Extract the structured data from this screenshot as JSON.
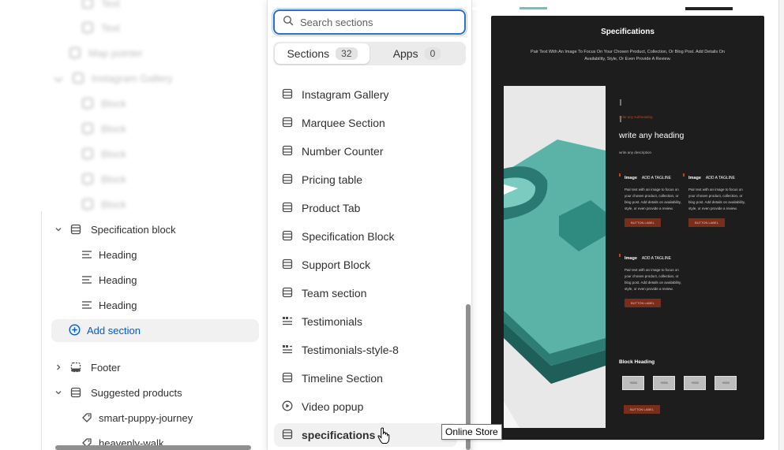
{
  "tree": {
    "blurred_items": [
      "Text",
      "Text",
      "Map pointer",
      "Instagram Gallery",
      "Block",
      "Block",
      "Block",
      "Block",
      "Block"
    ],
    "specification_block": {
      "label": "Specification block",
      "children": [
        "Heading",
        "Heading",
        "Heading"
      ]
    },
    "add_section_label": "Add section",
    "footer_label": "Footer",
    "suggested_products": {
      "label": "Suggested products",
      "children": [
        "smart-puppy-journey",
        "heavenly-walk"
      ]
    }
  },
  "picker": {
    "search_placeholder": "Search sections",
    "tabs": [
      {
        "label": "Sections",
        "count": "32",
        "active": true
      },
      {
        "label": "Apps",
        "count": "0",
        "active": false
      }
    ],
    "items": [
      {
        "label": "Instagram Gallery",
        "icon": "section-icon"
      },
      {
        "label": "Marquee Section",
        "icon": "section-icon"
      },
      {
        "label": "Number Counter",
        "icon": "section-icon"
      },
      {
        "label": "Pricing table",
        "icon": "section-icon"
      },
      {
        "label": "Product Tab",
        "icon": "section-icon"
      },
      {
        "label": "Specification Block",
        "icon": "section-icon"
      },
      {
        "label": "Support Block",
        "icon": "section-icon"
      },
      {
        "label": "Team section",
        "icon": "section-icon"
      },
      {
        "label": "Testimonials",
        "icon": "testimonial-icon"
      },
      {
        "label": "Testimonials-style-8",
        "icon": "testimonial-icon"
      },
      {
        "label": "Timeline Section",
        "icon": "section-icon"
      },
      {
        "label": "Video popup",
        "icon": "play-icon"
      },
      {
        "label": "specifications",
        "icon": "section-icon",
        "selected": true
      }
    ]
  },
  "tooltip": "Online Store",
  "preview": {
    "title": "Specifications",
    "subtitle": "Pair Text With An Image To Focus On Your Chosen Product, Collection, Or Blog Post. Add Details On Availability, Style, Or Even Provide A Review.",
    "small_label": "write any subheading",
    "heading": "write any heading",
    "description": "write any description",
    "cards": [
      {
        "title": "Image",
        "tagline": "ADD A TAGLINE",
        "body": "Pair text with an image to focus on your chosen product, collection, or blog post. Add details on availability, style, or even provide a review.",
        "button": "BUTTON LABEL"
      },
      {
        "title": "Image",
        "tagline": "ADD A TAGLINE",
        "body": "Pair text with an image to focus on your chosen product, collection, or blog post. Add details on availability, style, or even provide a review.",
        "button": "BUTTON LABEL"
      },
      {
        "title": "Image",
        "tagline": "ADD A TAGLINE",
        "body": "Pair text with an image to focus on your chosen product, collection, or blog post. Add details on availability, style, or even provide a review.",
        "button": "BUTTON LABEL"
      }
    ],
    "block_heading": "Block Heading",
    "boxes": [
      "+0000",
      "+0000",
      "+0000",
      "+0000"
    ],
    "bottom_button": "BUTTON LABEL"
  },
  "colors": {
    "accent": "#005bd3",
    "focus": "#2c6ecb",
    "preview_bg": "#1d1d1d",
    "button_brown": "#7a2d1a",
    "teal": "#5bb3a8"
  }
}
